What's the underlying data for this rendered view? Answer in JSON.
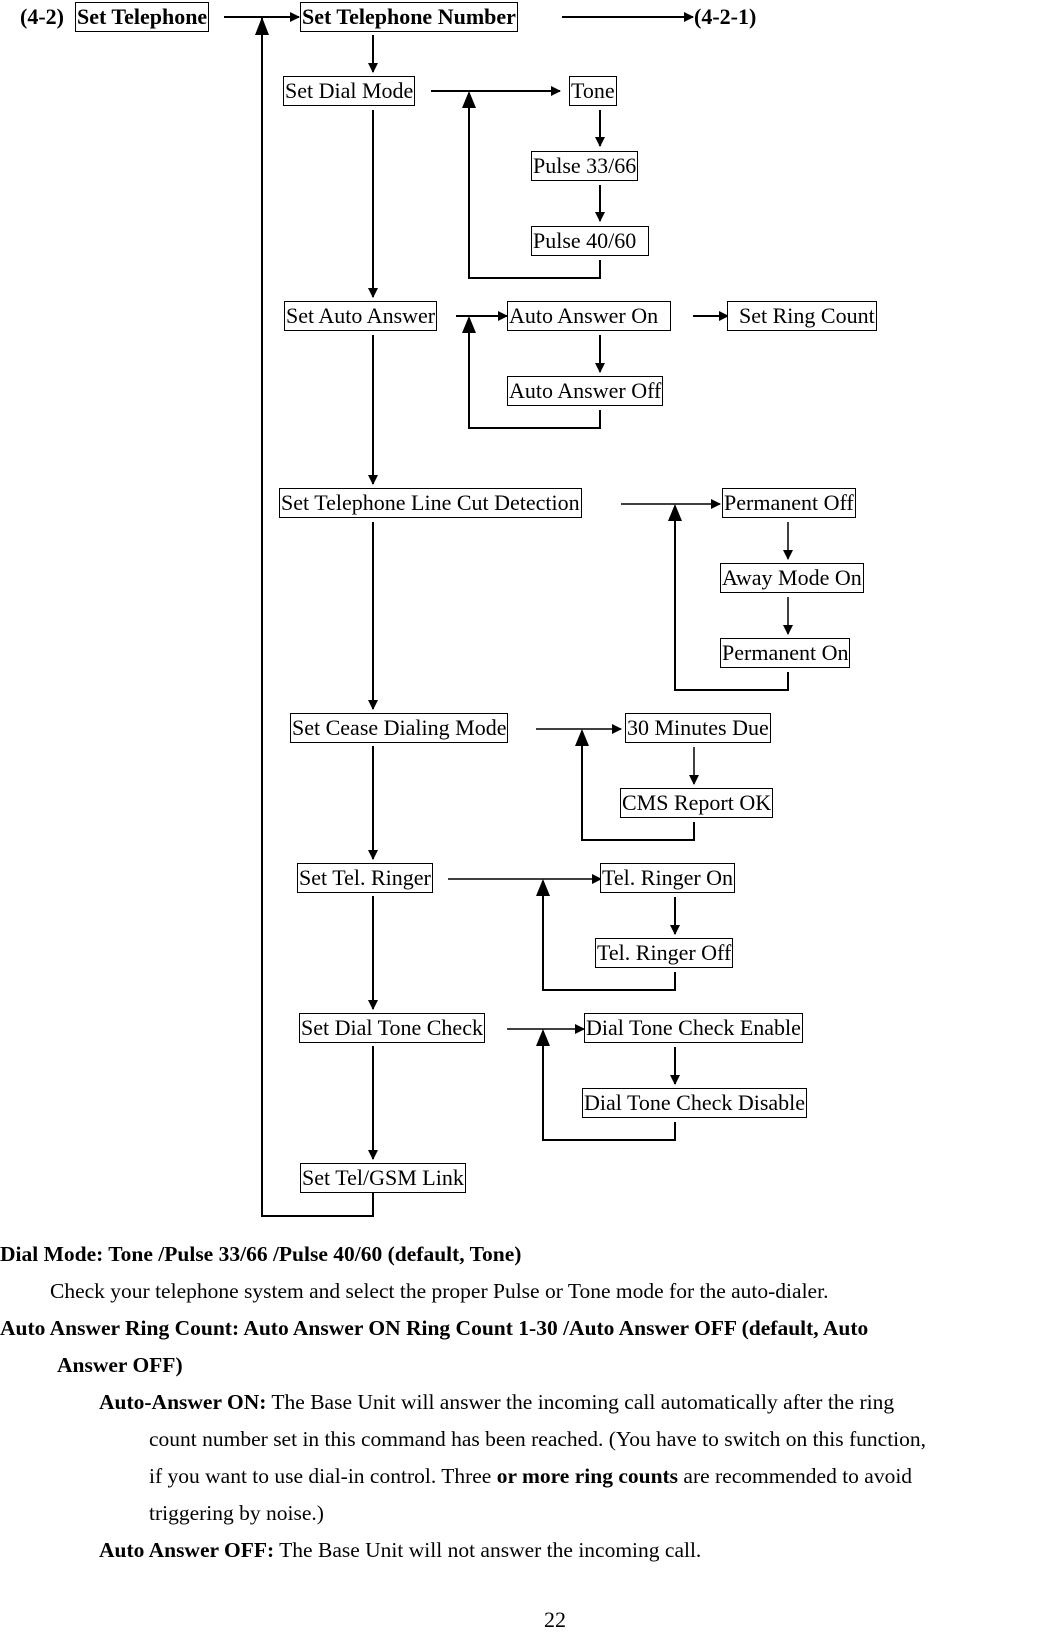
{
  "diagram": {
    "section_label": "(4-2)",
    "root": "Set Telephone",
    "next_ref": "(4-2-1)",
    "nodes": {
      "set_telephone_number": "Set Telephone Number",
      "set_dial_mode": "Set Dial Mode",
      "tone": "Tone",
      "pulse_33_66": "Pulse 33/66",
      "pulse_40_60": "Pulse 40/60",
      "set_auto_answer": "Set Auto Answer",
      "auto_answer_on": "Auto Answer On",
      "set_ring_count": "Set Ring Count",
      "auto_answer_off": "Auto Answer Off",
      "set_line_cut": "Set Telephone Line Cut Detection",
      "permanent_off": "Permanent Off",
      "away_mode_on": "Away Mode On",
      "permanent_on": "Permanent On",
      "set_cease_dialing": "Set Cease Dialing Mode",
      "thirty_minutes_due": "30 Minutes Due",
      "cms_report_ok": "CMS Report OK",
      "set_tel_ringer": "Set Tel. Ringer",
      "tel_ringer_on": "Tel. Ringer On",
      "tel_ringer_off": "Tel. Ringer Off",
      "set_dial_tone_check": "Set Dial Tone Check",
      "dial_tone_enable": "Dial Tone Check Enable",
      "dial_tone_disable": "Dial Tone Check Disable",
      "set_tel_gsm_link": "Set Tel/GSM Link"
    }
  },
  "body": {
    "dial_mode_heading": "Dial Mode: Tone /Pulse 33/66 /Pulse 40/60 (default, Tone)",
    "dial_mode_text": "Check your telephone system and select the proper Pulse or Tone mode for the auto-dialer.",
    "auto_answer_heading_1": "Auto Answer Ring Count: Auto Answer ON Ring Count 1-30 /Auto Answer OFF (default, Auto",
    "auto_answer_heading_2": "Answer OFF)",
    "aa_on_label": "Auto-Answer ON:",
    "aa_on_text_1": " The Base Unit will answer the incoming call automatically after the ring",
    "aa_on_text_2": "count number set in this command has been reached. (You have to switch on this function,",
    "aa_on_text_3a": "if you want to use dial-in control. Three ",
    "aa_on_text_3b": "or more ring counts",
    "aa_on_text_3c": " are recommended to avoid",
    "aa_on_text_4": "triggering by noise.)",
    "aa_off_label": "Auto Answer OFF:",
    "aa_off_text": " The Base Unit will not answer the incoming call."
  },
  "page_number": "22"
}
